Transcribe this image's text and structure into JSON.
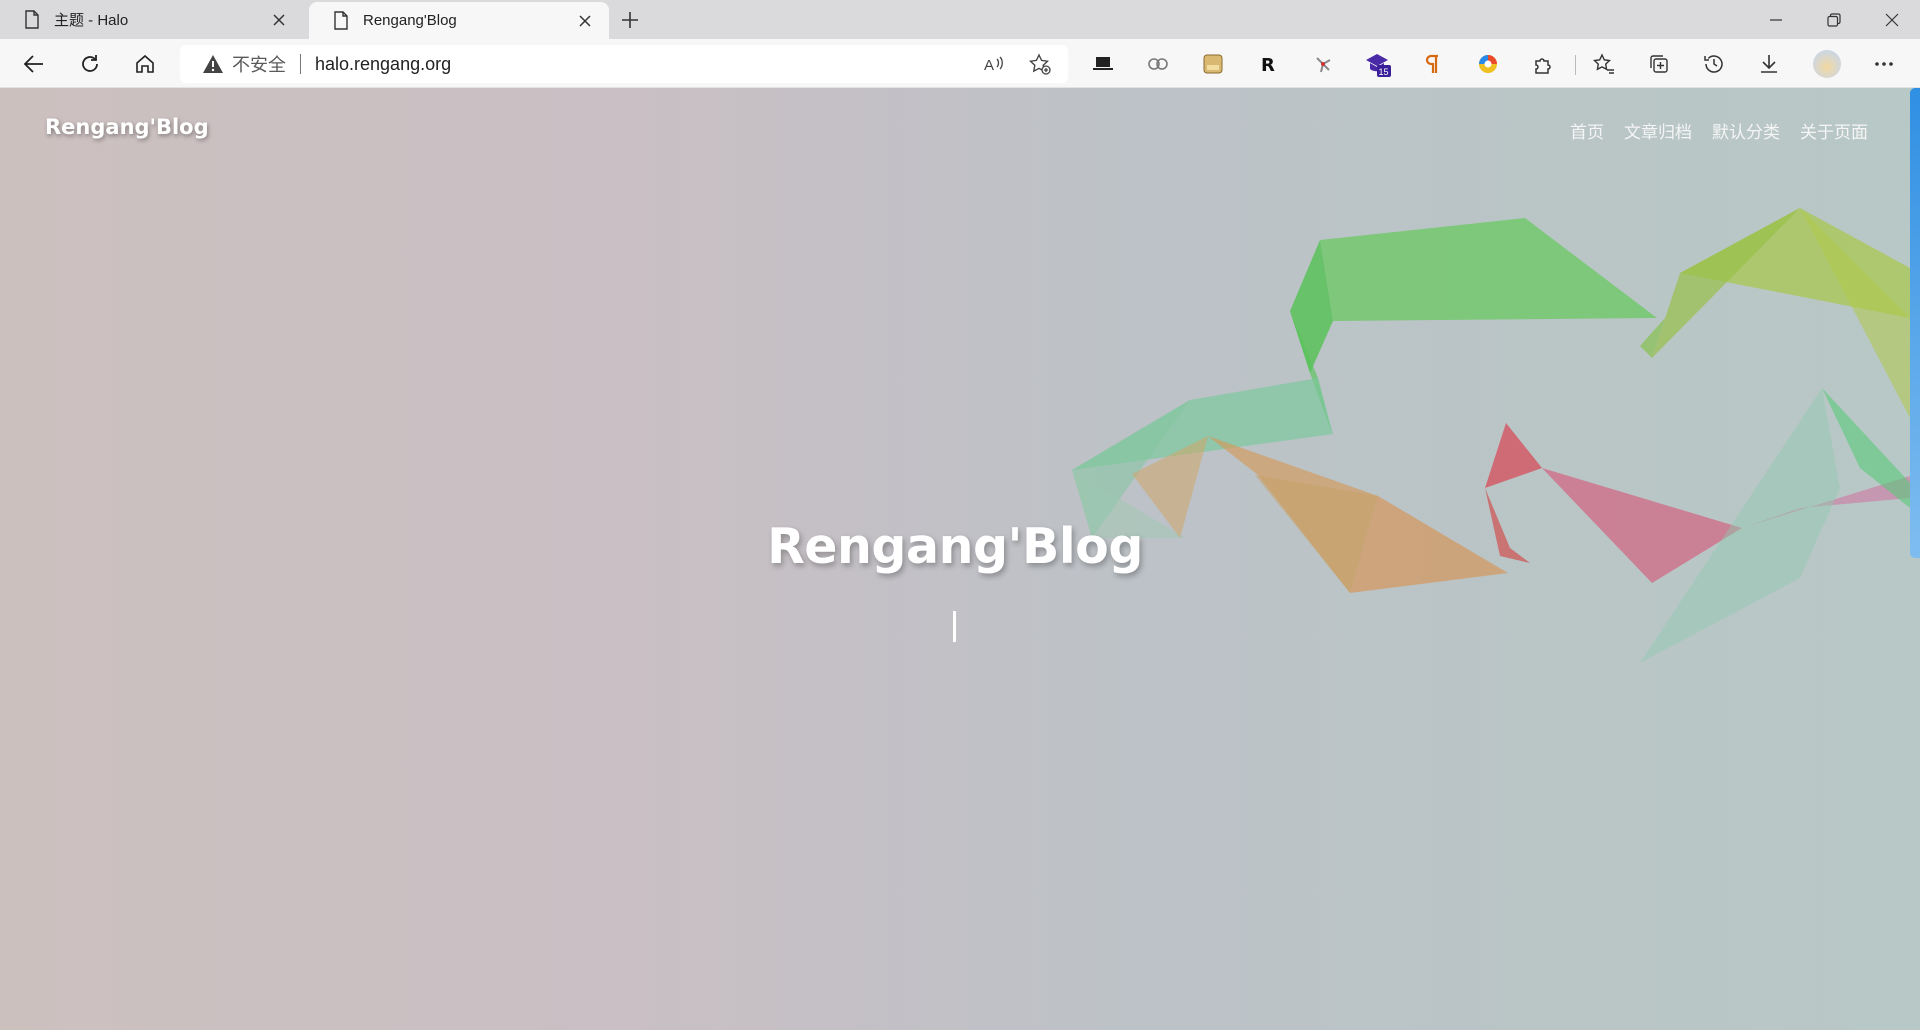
{
  "browser": {
    "tabs": [
      {
        "title": "主题 - Halo",
        "active": false
      },
      {
        "title": "Rengang'Blog",
        "active": true
      }
    ],
    "address": {
      "security_label": "不安全",
      "url": "halo.rengang.org"
    },
    "extension_badge": "15"
  },
  "site": {
    "logo": "Rengang'Blog",
    "menu": [
      "首页",
      "文章归档",
      "默认分类",
      "关于页面"
    ],
    "hero_title": "Rengang'Blog"
  },
  "colors": {
    "scrollbar": "#2f8fe3",
    "ribbon_green": "#5cc85a",
    "ribbon_lime": "#a8c848",
    "ribbon_teal": "#7ec8a0",
    "ribbon_orange": "#d49a5a",
    "ribbon_red": "#d85060",
    "ribbon_pink": "#d06a8a"
  }
}
